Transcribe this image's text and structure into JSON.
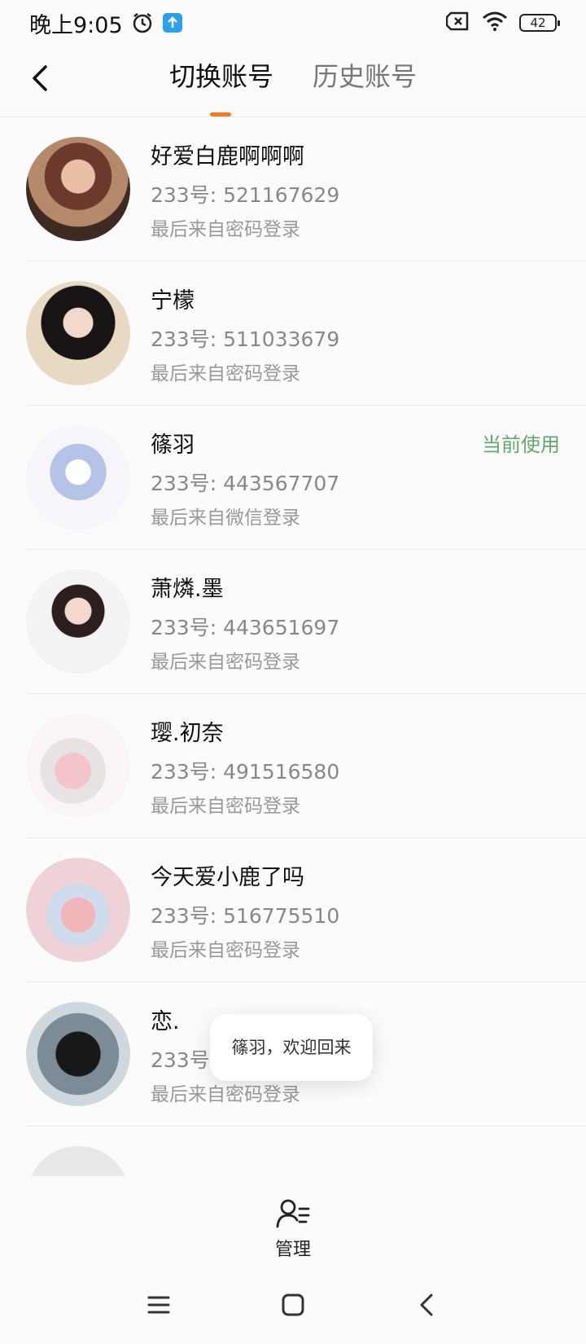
{
  "status_bar": {
    "time": "晚上9:05",
    "battery": "42"
  },
  "header": {
    "tabs": [
      {
        "label": "切换账号",
        "active": true
      },
      {
        "label": "历史账号",
        "active": false
      }
    ],
    "accent_color": "#f07a1e"
  },
  "accounts": [
    {
      "name": "好爱白鹿啊啊啊",
      "id": "233号: 521167629",
      "login": "最后来自密码登录",
      "current": ""
    },
    {
      "name": "宁檬",
      "id": "233号: 511033679",
      "login": "最后来自密码登录",
      "current": ""
    },
    {
      "name": "篠羽",
      "id": "233号: 443567707",
      "login": "最后来自微信登录",
      "current": "当前使用"
    },
    {
      "name": "萧燐.墨",
      "id": "233号: 443651697",
      "login": "最后来自密码登录",
      "current": ""
    },
    {
      "name": "璎.初奈",
      "id": "233号: 491516580",
      "login": "最后来自密码登录",
      "current": ""
    },
    {
      "name": "今天爱小鹿了吗",
      "id": "233号: 516775510",
      "login": "最后来自密码登录",
      "current": ""
    },
    {
      "name": "恋.",
      "id": "233号:",
      "login": "最后来自密码登录",
      "current": ""
    }
  ],
  "toast": "篠羽，欢迎回来",
  "bottom": {
    "manage_label": "管理"
  }
}
